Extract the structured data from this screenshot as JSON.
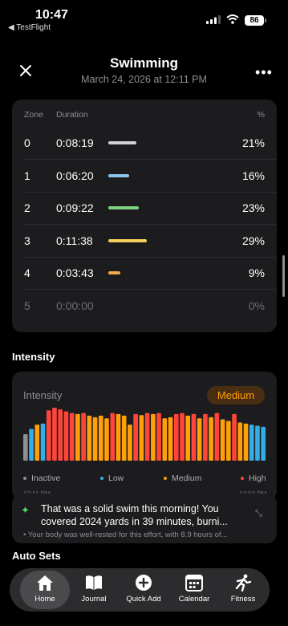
{
  "status": {
    "time": "10:47",
    "back_app": "◀ TestFlight",
    "battery": "86"
  },
  "header": {
    "title": "Swimming",
    "subtitle": "March 24, 2026 at 12:11 PM"
  },
  "zones": {
    "headers": {
      "zone": "Zone",
      "duration": "Duration",
      "percent": "%"
    },
    "rows": [
      {
        "zone": "0",
        "duration": "0:08:19",
        "percent": "21%",
        "fraction": 0.21,
        "color": "#d1d1d6"
      },
      {
        "zone": "1",
        "duration": "0:06:20",
        "percent": "16%",
        "fraction": 0.16,
        "color": "#8ec5f0"
      },
      {
        "zone": "2",
        "duration": "0:09:22",
        "percent": "23%",
        "fraction": 0.23,
        "color": "#7ed37f"
      },
      {
        "zone": "3",
        "duration": "0:11:38",
        "percent": "29%",
        "fraction": 0.29,
        "color": "#f5cf5c"
      },
      {
        "zone": "4",
        "duration": "0:03:43",
        "percent": "9%",
        "fraction": 0.09,
        "color": "#f4a949"
      },
      {
        "zone": "5",
        "duration": "0:00:00",
        "percent": "0%",
        "fraction": 0.0,
        "color": "#6e6e73"
      }
    ]
  },
  "intensity": {
    "section_title": "Intensity",
    "card_label": "Intensity",
    "level": "Medium",
    "colors": {
      "Inactive": "#8e8e93",
      "Low": "#32ade6",
      "Medium": "#ff9f0a",
      "High": "#ff453a"
    },
    "legend": [
      "Inactive",
      "Low",
      "Medium",
      "High"
    ],
    "axis_peek_left": "12:11 PM",
    "axis_peek_right": "12:50 PM",
    "bars": [
      {
        "level": "Inactive",
        "value": 0.5
      },
      {
        "level": "Low",
        "value": 0.6
      },
      {
        "level": "Medium",
        "value": 0.68
      },
      {
        "level": "Low",
        "value": 0.7
      },
      {
        "level": "High",
        "value": 0.95
      },
      {
        "level": "High",
        "value": 1.0
      },
      {
        "level": "High",
        "value": 0.97
      },
      {
        "level": "High",
        "value": 0.93
      },
      {
        "level": "High",
        "value": 0.9
      },
      {
        "level": "Medium",
        "value": 0.88
      },
      {
        "level": "High",
        "value": 0.9
      },
      {
        "level": "Medium",
        "value": 0.85
      },
      {
        "level": "Medium",
        "value": 0.82
      },
      {
        "level": "Medium",
        "value": 0.85
      },
      {
        "level": "Medium",
        "value": 0.8
      },
      {
        "level": "High",
        "value": 0.9
      },
      {
        "level": "Medium",
        "value": 0.88
      },
      {
        "level": "Medium",
        "value": 0.85
      },
      {
        "level": "Medium",
        "value": 0.68
      },
      {
        "level": "High",
        "value": 0.88
      },
      {
        "level": "Medium",
        "value": 0.86
      },
      {
        "level": "High",
        "value": 0.9
      },
      {
        "level": "Medium",
        "value": 0.88
      },
      {
        "level": "High",
        "value": 0.9
      },
      {
        "level": "Medium",
        "value": 0.8
      },
      {
        "level": "Medium",
        "value": 0.82
      },
      {
        "level": "High",
        "value": 0.88
      },
      {
        "level": "High",
        "value": 0.9
      },
      {
        "level": "Medium",
        "value": 0.85
      },
      {
        "level": "High",
        "value": 0.88
      },
      {
        "level": "Medium",
        "value": 0.8
      },
      {
        "level": "High",
        "value": 0.88
      },
      {
        "level": "Medium",
        "value": 0.82
      },
      {
        "level": "High",
        "value": 0.9
      },
      {
        "level": "Medium",
        "value": 0.78
      },
      {
        "level": "Medium",
        "value": 0.75
      },
      {
        "level": "High",
        "value": 0.88
      },
      {
        "level": "Medium",
        "value": 0.72
      },
      {
        "level": "Medium",
        "value": 0.7
      },
      {
        "level": "Low",
        "value": 0.68
      },
      {
        "level": "Low",
        "value": 0.66
      },
      {
        "level": "Low",
        "value": 0.64
      }
    ]
  },
  "toast": {
    "message": "That was a solid swim this morning! You covered 2024 yards in 39 minutes, burni...",
    "detail": "• Your body was well-rested for this effort, with 8.9 hours of..."
  },
  "auto_sets": {
    "section_title": "Auto Sets"
  },
  "tabs": [
    {
      "label": "Home",
      "icon": "home-icon"
    },
    {
      "label": "Journal",
      "icon": "book-icon"
    },
    {
      "label": "Quick Add",
      "icon": "plus-circle-icon"
    },
    {
      "label": "Calendar",
      "icon": "calendar-icon"
    },
    {
      "label": "Fitness",
      "icon": "running-icon"
    }
  ]
}
